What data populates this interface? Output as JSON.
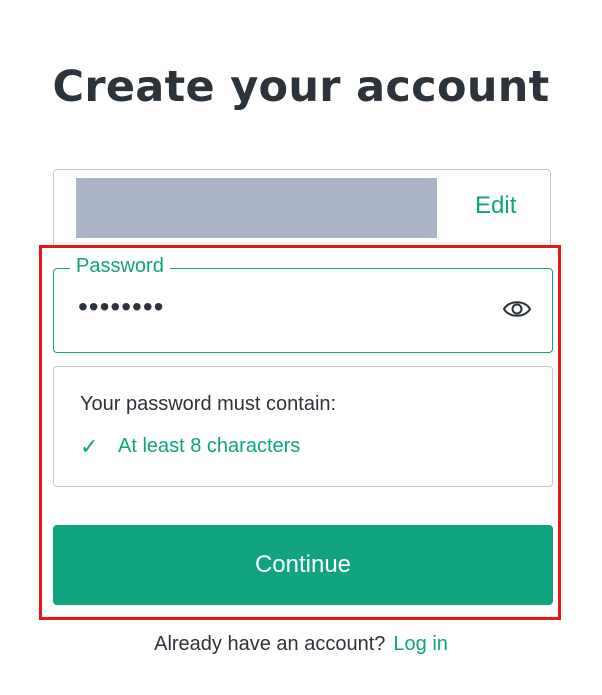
{
  "page": {
    "title": "Create your account"
  },
  "email": {
    "edit_label": "Edit"
  },
  "password": {
    "label": "Password",
    "value": "••••••••",
    "toggle_icon": "eye-icon"
  },
  "requirements": {
    "title": "Your password must contain:",
    "items": [
      {
        "icon": "checkmark-icon",
        "glyph": "✓",
        "label": "At least 8 characters",
        "met": true
      }
    ]
  },
  "actions": {
    "continue_label": "Continue"
  },
  "footer": {
    "prompt": "Already have an account?",
    "login_label": "Log in"
  },
  "colors": {
    "accent": "#10a37f",
    "text": "#2d333a",
    "border": "#c2c8d0",
    "highlight": "#e8141a",
    "redaction": "#aab4c6"
  }
}
